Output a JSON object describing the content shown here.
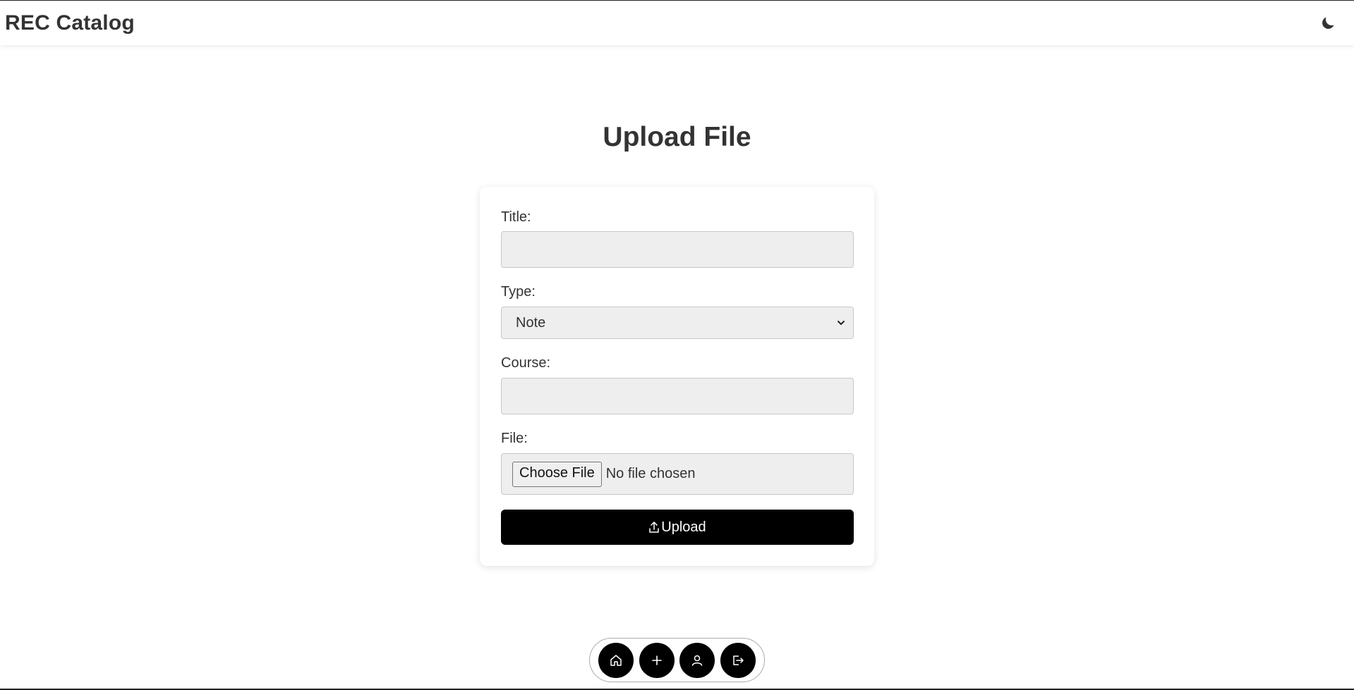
{
  "header": {
    "brand": "REC Catalog",
    "theme_toggle_icon": "moon-icon"
  },
  "page": {
    "title": "Upload File"
  },
  "form": {
    "title_label": "Title:",
    "title_value": "",
    "type_label": "Type:",
    "type_selected": "Note",
    "course_label": "Course:",
    "course_value": "",
    "file_label": "File:",
    "choose_file_label": "Choose File",
    "file_status": "No file chosen",
    "upload_label": "Upload",
    "upload_icon": "upload-icon"
  },
  "bottom_nav": {
    "items": [
      {
        "icon": "home-icon"
      },
      {
        "icon": "plus-icon"
      },
      {
        "icon": "user-icon"
      },
      {
        "icon": "logout-icon"
      }
    ]
  },
  "colors": {
    "primary": "#000000",
    "input_bg": "#eeeeee",
    "text": "#333333"
  }
}
